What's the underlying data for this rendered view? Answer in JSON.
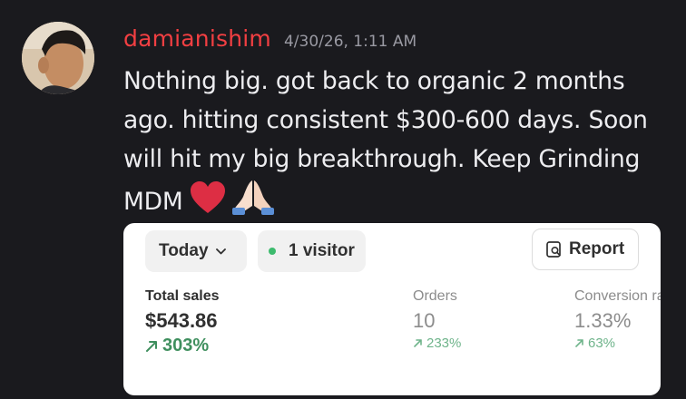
{
  "message": {
    "author": "damianishim",
    "timestamp": "4/30/26, 1:11 AM",
    "text": "Nothing big. got back to organic 2 months ago. hitting consistent $300-600 days. Soon will hit my big breakthrough. Keep Grinding MDM",
    "emojis": [
      "red-heart-emoji",
      "folded-hands-emoji"
    ],
    "author_color": "#f23f42"
  },
  "attachment": {
    "date_filter": "Today",
    "visitors": "1 visitor",
    "report_label": "Report",
    "metrics": {
      "total_sales": {
        "label": "Total sales",
        "value": "$543.86",
        "change": "303%"
      },
      "orders": {
        "label": "Orders",
        "value": "10",
        "change": "233%"
      },
      "conversion": {
        "label": "Conversion rate",
        "value": "1.33%",
        "change": "63%"
      }
    },
    "accent_green": "#3f8f5e"
  }
}
